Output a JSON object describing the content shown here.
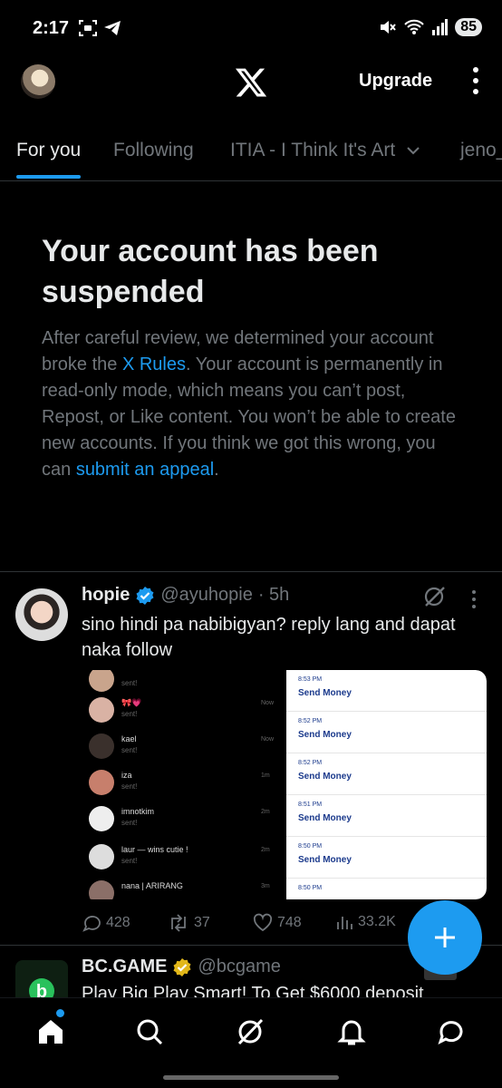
{
  "status_bar": {
    "time": "2:17",
    "battery": "85"
  },
  "header": {
    "upgrade_label": "Upgrade"
  },
  "tabs": [
    {
      "label": "For you"
    },
    {
      "label": "Following"
    },
    {
      "label": "ITIA - I Think It's Art"
    },
    {
      "label": "jeno_"
    }
  ],
  "notice": {
    "title": "Your account has been suspended",
    "text_1": "After careful review, we determined your account broke the ",
    "link_1": "X Rules",
    "text_2": ". Your account is permanently in read-only mode, which means you can’t post, Repost, or Like content. You won’t be able to create new accounts. If you think we got this wrong, you can ",
    "link_2": "submit an appeal",
    "text_3": "."
  },
  "tweet": {
    "name": "hopie",
    "handle": "@ayuhopie",
    "time": "· 5h",
    "text": "sino hindi pa nabibigyan? reply lang and dapat naka follow",
    "embed": {
      "chats": [
        {
          "name": "",
          "sub": "sent!",
          "time": ""
        },
        {
          "name": "🎀💗",
          "sub": "sent!",
          "time": "Now"
        },
        {
          "name": "kael",
          "sub": "sent!",
          "time": "Now"
        },
        {
          "name": "iza",
          "sub": "sent!",
          "time": "1m"
        },
        {
          "name": "imnotkim",
          "sub": "sent!",
          "time": "2m"
        },
        {
          "name": "laur — wins cutie !",
          "sub": "sent!",
          "time": "2m"
        },
        {
          "name": "nana | ARIRANG",
          "sub": "",
          "time": "3m"
        }
      ],
      "payments": [
        {
          "time": "8:53 PM",
          "label": "Send Money"
        },
        {
          "time": "8:52 PM",
          "label": "Send Money"
        },
        {
          "time": "8:52 PM",
          "label": "Send Money"
        },
        {
          "time": "8:51 PM",
          "label": "Send Money"
        },
        {
          "time": "8:50 PM",
          "label": "Send Money"
        },
        {
          "time": "8:50 PM",
          "label": ""
        }
      ]
    },
    "replies": "428",
    "reposts": "37",
    "likes": "748",
    "views": "33.2K"
  },
  "promo": {
    "name": "BC.GAME",
    "handle": "@bcgame",
    "text": "Play Big Play Smart! To Get $6000 deposit"
  },
  "colors": {
    "accent": "#1d9bf0",
    "muted": "#71767b",
    "verified_blue": "#1d9bf0",
    "verified_gold": "#e2b719"
  }
}
